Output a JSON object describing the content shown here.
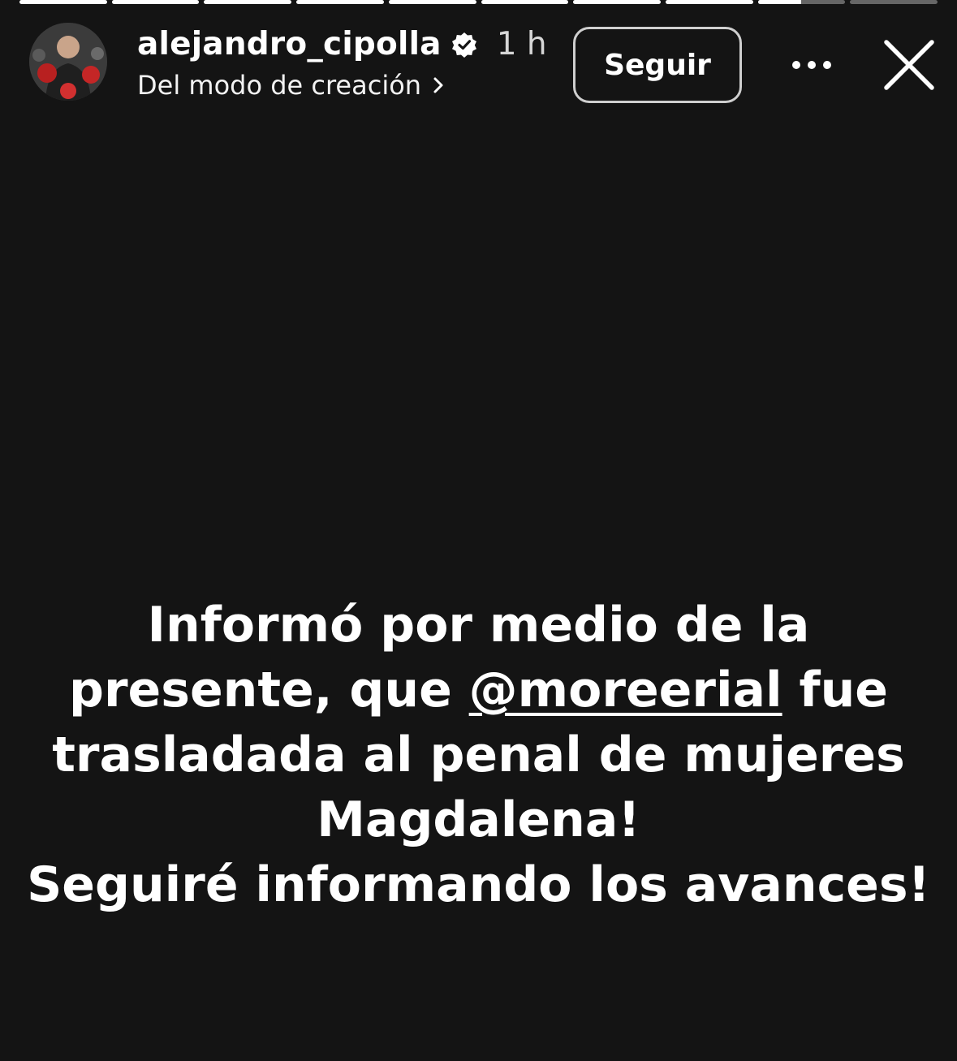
{
  "story": {
    "progress_segments": [
      1,
      1,
      1,
      1,
      1,
      1,
      1,
      1,
      0.5,
      0
    ],
    "user": {
      "username": "alejandro_cipolla",
      "verified": true,
      "time": "1 h",
      "subtitle": "Del modo de creación"
    },
    "actions": {
      "follow_label": "Seguir",
      "more_icon": "more-horizontal-icon",
      "close_icon": "close-icon"
    },
    "caption": {
      "line1": "Informó por medio de la",
      "line2_before": "presente, que ",
      "mention": "@moreerial",
      "line2_after": " fue",
      "line3": "trasladada al penal de mujeres",
      "line4": "Magdalena!",
      "line5": "Seguiré informando los avances!"
    }
  }
}
